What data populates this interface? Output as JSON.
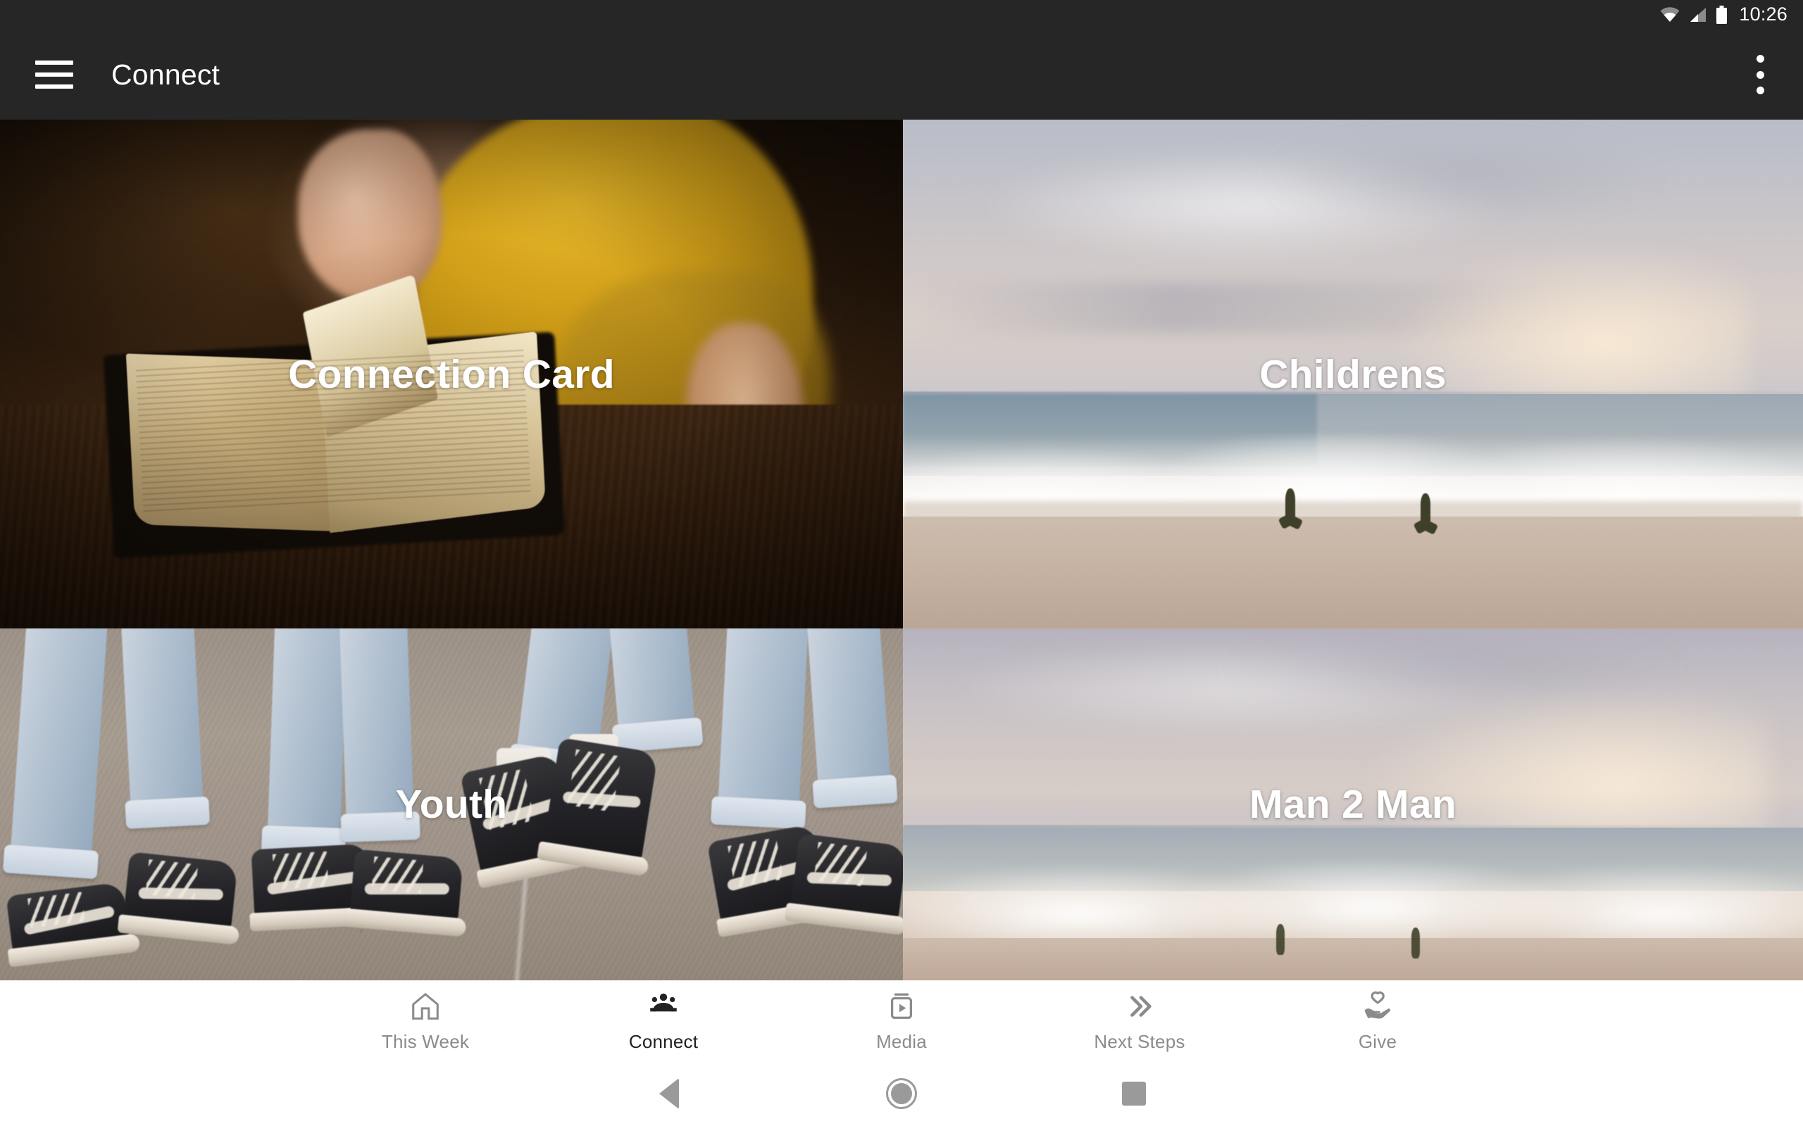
{
  "status_bar": {
    "time": "10:26",
    "icons": [
      "wifi-icon",
      "cell-signal-icon",
      "battery-icon"
    ]
  },
  "app_bar": {
    "menu_icon": "hamburger-menu-icon",
    "title": "Connect",
    "overflow_icon": "more-vertical-icon",
    "background": "#262626",
    "text_color": "#ffffff"
  },
  "tiles": [
    {
      "label": "Connection Card",
      "art": "bible-open-book-photo"
    },
    {
      "label": "Childrens",
      "art": "beach-wave-runners-photo"
    },
    {
      "label": "Youth",
      "art": "sneakers-jeans-street-photo"
    },
    {
      "label": "Man 2 Man",
      "art": "beach-sunset-photo"
    }
  ],
  "bottom_nav": {
    "active_index": 1,
    "active_color": "#222222",
    "inactive_color": "#8b8b8b",
    "items": [
      {
        "label": "This Week",
        "icon": "home-icon"
      },
      {
        "label": "Connect",
        "icon": "people-group-icon"
      },
      {
        "label": "Media",
        "icon": "video-play-icon"
      },
      {
        "label": "Next Steps",
        "icon": "double-chevron-right-icon"
      },
      {
        "label": "Give",
        "icon": "hand-heart-icon"
      }
    ]
  },
  "system_nav": {
    "back": "back-triangle-icon",
    "home": "home-circle-icon",
    "recents": "recents-square-icon"
  }
}
